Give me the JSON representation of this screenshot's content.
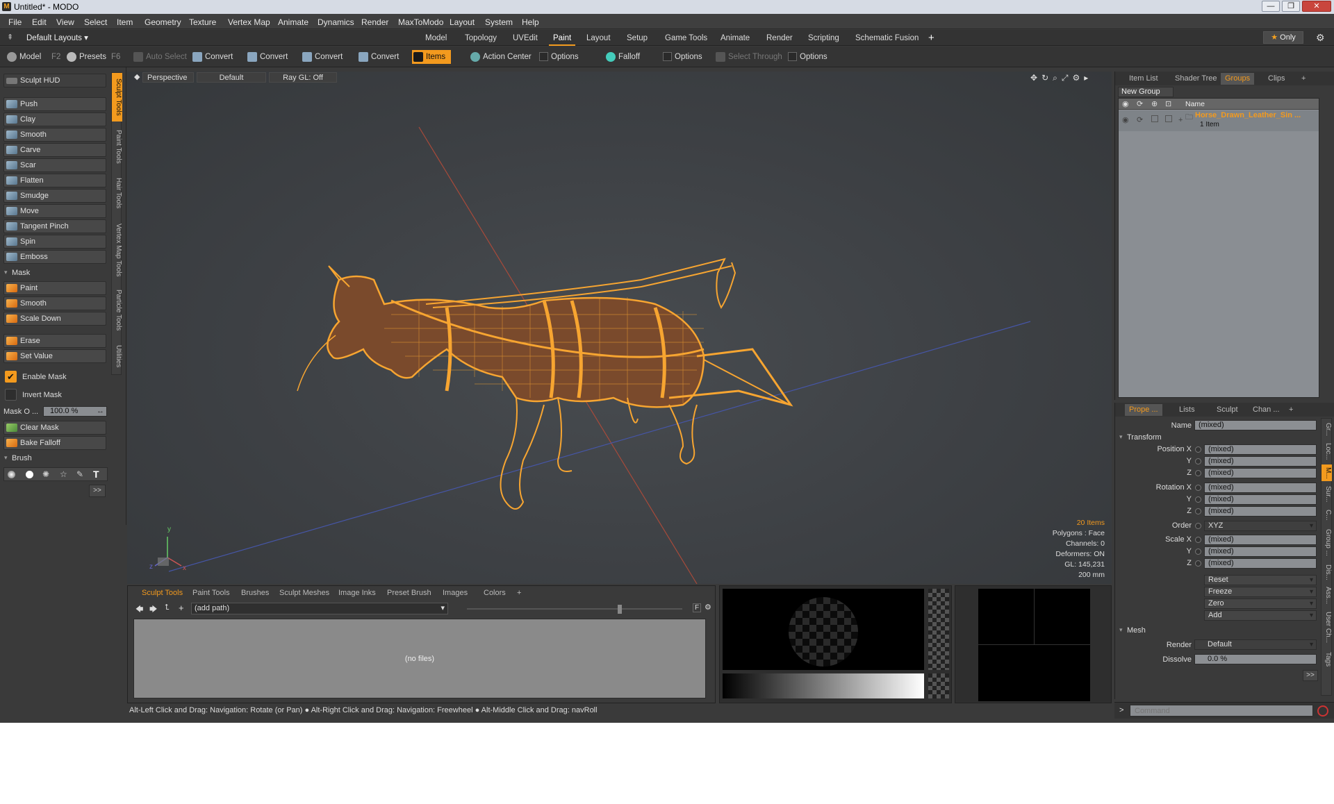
{
  "window": {
    "title": "Untitled* - MODO",
    "buttons": [
      "—",
      "❐",
      "✕"
    ]
  },
  "menu": [
    "File",
    "Edit",
    "View",
    "Select",
    "Item",
    "Geometry",
    "Texture",
    "Vertex Map",
    "Animate",
    "Dynamics",
    "Render",
    "MaxToModo",
    "Layout",
    "System",
    "Help"
  ],
  "layout_dropdown": "Default Layouts",
  "layout_tabs": [
    "Model",
    "Topology",
    "UVEdit",
    "Paint",
    "Layout",
    "Setup",
    "Game Tools",
    "Animate",
    "Render",
    "Scripting",
    "Schematic Fusion",
    "+"
  ],
  "active_layout_tab": "Paint",
  "only_button": "Only",
  "toolbar": {
    "model": "Model",
    "model_key": "F2",
    "presets": "Presets",
    "presets_key": "F6",
    "auto_select": "Auto Select",
    "convert1": "Convert",
    "convert2": "Convert",
    "convert3": "Convert",
    "convert4": "Convert",
    "items": "Items",
    "action_center": "Action Center",
    "options1": "Options",
    "falloff": "Falloff",
    "options2": "Options",
    "select_through": "Select Through",
    "options3": "Options"
  },
  "left_panel": {
    "sculpt_hud": "Sculpt HUD",
    "sculpt_tools": [
      "Push",
      "Clay",
      "Smooth",
      "Carve",
      "Scar",
      "Flatten",
      "Smudge",
      "Move",
      "Tangent Pinch",
      "Spin",
      "Emboss"
    ],
    "mask_header": "Mask",
    "mask_tools": [
      "Paint",
      "Smooth",
      "Scale Down"
    ],
    "mask_tools2": [
      "Erase",
      "Set Value"
    ],
    "enable_mask": "Enable Mask",
    "invert_mask": "Invert Mask",
    "mask_opacity_label": "Mask O ...",
    "mask_opacity_value": "100.0 %",
    "clear_mask": "Clear Mask",
    "bake_falloff": "Bake Falloff",
    "brush_header": "Brush",
    "more": ">>",
    "vertical_tabs": [
      "Sculpt Tools",
      "Paint Tools",
      "Hair Tools",
      "Vertex Map Tools",
      "Particle Tools",
      "Utilities"
    ]
  },
  "viewport": {
    "labels": [
      "Perspective",
      "Default",
      "Ray GL: Off"
    ],
    "stats": {
      "items": "20 Items",
      "polygons": "Polygons : Face",
      "channels": "Channels: 0",
      "deformers": "Deformers: ON",
      "gl": "GL: 145,231",
      "scale": "200 mm"
    },
    "axis": {
      "x": "x",
      "y": "y",
      "z": "z"
    }
  },
  "bottom_panel": {
    "tabs": [
      "Sculpt Tools",
      "Paint Tools",
      "Brushes",
      "Sculpt Meshes",
      "Image Inks",
      "Preset Brush",
      "Images",
      "Colors",
      "+"
    ],
    "path": "(add path)",
    "empty": "(no files)",
    "f_label": "F"
  },
  "status_bar": "Alt-Left Click and Drag: Navigation: Rotate (or Pan) ● Alt-Right Click and Drag: Navigation: Freewheel ● Alt-Middle Click and Drag: navRoll",
  "right_top": {
    "tabs": [
      "Item List",
      "Shader Tree",
      "Groups",
      "Clips",
      "+"
    ],
    "new_group": "New Group",
    "name_col": "Name",
    "group_name": "Horse_Drawn_Leather_Sin ...",
    "group_count": "1 Item"
  },
  "properties": {
    "tabs": [
      "Prope ...",
      "Lists",
      "Sculpt",
      "Chan ...",
      "+"
    ],
    "name_label": "Name",
    "name_value": "(mixed)",
    "transform": "Transform",
    "position": {
      "label": "Position X",
      "y": "Y",
      "z": "Z",
      "values": [
        "(mixed)",
        "(mixed)",
        "(mixed)"
      ]
    },
    "rotation": {
      "label": "Rotation X",
      "y": "Y",
      "z": "Z",
      "values": [
        "(mixed)",
        "(mixed)",
        "(mixed)"
      ]
    },
    "order_label": "Order",
    "order_value": "XYZ",
    "scale": {
      "label": "Scale X",
      "y": "Y",
      "z": "Z",
      "values": [
        "(mixed)",
        "(mixed)",
        "(mixed)"
      ]
    },
    "actions": [
      "Reset",
      "Freeze",
      "Zero",
      "Add"
    ],
    "mesh": "Mesh",
    "render_label": "Render",
    "render_value": "Default",
    "dissolve_label": "Dissolve",
    "dissolve_value": "0.0 %",
    "side_tabs": [
      "Gr...",
      "Loc...",
      "M...",
      "Sur...",
      "C...",
      "Group ...",
      "Dis...",
      "Ass...",
      "User Ch...",
      "Tags"
    ]
  },
  "command": {
    "prompt": ">",
    "placeholder": "Command"
  },
  "colors": {
    "accent": "#f39a1e",
    "wire": "#f7a531",
    "background": "#3a3a3a"
  }
}
